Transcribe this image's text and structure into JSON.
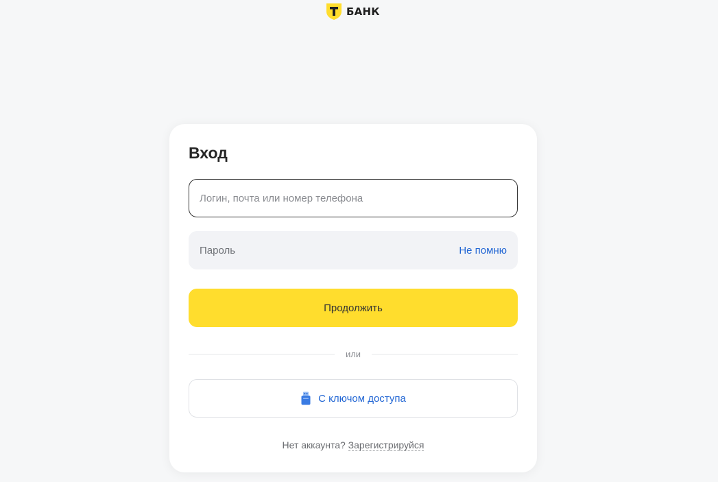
{
  "brand": {
    "name": "БАНК",
    "accent_color": "#ffdd2d",
    "logo_icon": "t-shield-icon"
  },
  "login": {
    "title": "Вход",
    "login_placeholder": "Логин, почта или номер телефона",
    "login_value": "",
    "password_placeholder": "Пароль",
    "password_value": "",
    "forgot_label": "Не помню",
    "continue_label": "Продолжить",
    "divider_text": "или",
    "key_icon": "usb-key-icon",
    "key_label": "С ключом доступа",
    "no_account_text": "Нет аккаунта?",
    "register_label": "Зарегистрируйся",
    "link_color": "#2367d4"
  }
}
